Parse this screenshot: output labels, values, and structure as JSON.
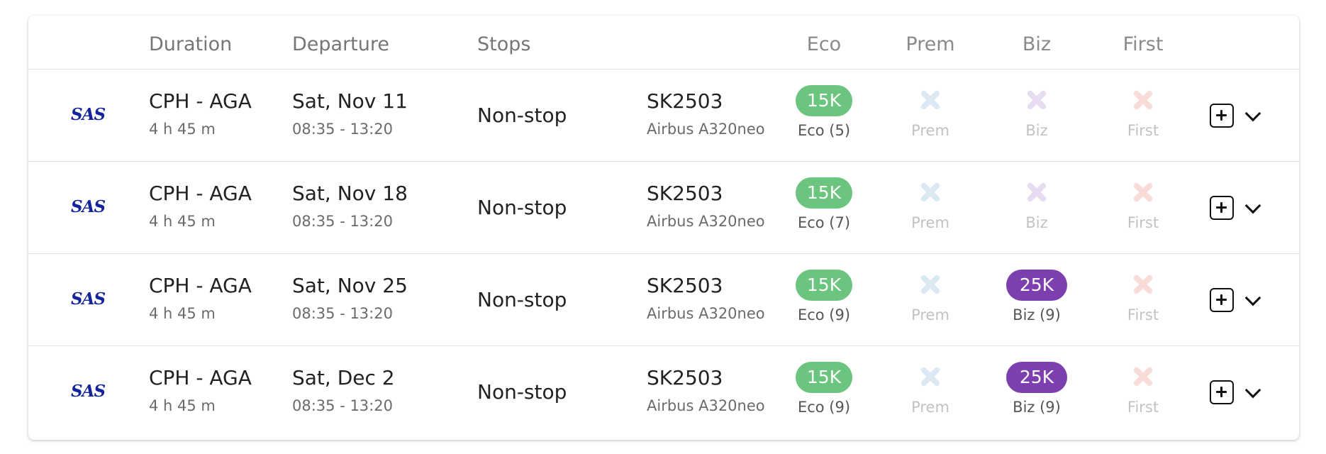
{
  "colors": {
    "eco_pill": "#6cc57e",
    "biz_pill": "#7e3fae",
    "prem_unavailable": "#dbe9f5",
    "biz_unavailable": "#e8dcf2",
    "first_unavailable": "#f9dcd8",
    "airline_logo": "#13249b"
  },
  "header": {
    "duration": "Duration",
    "departure": "Departure",
    "stops": "Stops",
    "eco": "Eco",
    "prem": "Prem",
    "biz": "Biz",
    "first": "First"
  },
  "rows": [
    {
      "airline_logo": "SAS",
      "route": "CPH - AGA",
      "duration": "4 h 45 m",
      "date": "Sat, Nov 11",
      "times": "08:35 - 13:20",
      "stops": "Non-stop",
      "flight": "SK2503",
      "aircraft": "Airbus A320neo",
      "eco": {
        "price": "15K",
        "label": "Eco (5)"
      },
      "prem": {
        "label": "Prem",
        "icon": "x-icon"
      },
      "biz": {
        "label": "Biz",
        "icon": "x-icon"
      },
      "first": {
        "label": "First",
        "icon": "x-icon"
      }
    },
    {
      "airline_logo": "SAS",
      "route": "CPH - AGA",
      "duration": "4 h 45 m",
      "date": "Sat, Nov 18",
      "times": "08:35 - 13:20",
      "stops": "Non-stop",
      "flight": "SK2503",
      "aircraft": "Airbus A320neo",
      "eco": {
        "price": "15K",
        "label": "Eco (7)"
      },
      "prem": {
        "label": "Prem",
        "icon": "x-icon"
      },
      "biz": {
        "label": "Biz",
        "icon": "x-icon"
      },
      "first": {
        "label": "First",
        "icon": "x-icon"
      }
    },
    {
      "airline_logo": "SAS",
      "route": "CPH - AGA",
      "duration": "4 h 45 m",
      "date": "Sat, Nov 25",
      "times": "08:35 - 13:20",
      "stops": "Non-stop",
      "flight": "SK2503",
      "aircraft": "Airbus A320neo",
      "eco": {
        "price": "15K",
        "label": "Eco (9)"
      },
      "prem": {
        "label": "Prem",
        "icon": "x-icon"
      },
      "biz": {
        "price": "25K",
        "label": "Biz (9)"
      },
      "first": {
        "label": "First",
        "icon": "x-icon"
      }
    },
    {
      "airline_logo": "SAS",
      "route": "CPH - AGA",
      "duration": "4 h 45 m",
      "date": "Sat, Dec 2",
      "times": "08:35 - 13:20",
      "stops": "Non-stop",
      "flight": "SK2503",
      "aircraft": "Airbus A320neo",
      "eco": {
        "price": "15K",
        "label": "Eco (9)"
      },
      "prem": {
        "label": "Prem",
        "icon": "x-icon"
      },
      "biz": {
        "price": "25K",
        "label": "Biz (9)"
      },
      "first": {
        "label": "First",
        "icon": "x-icon"
      }
    }
  ]
}
